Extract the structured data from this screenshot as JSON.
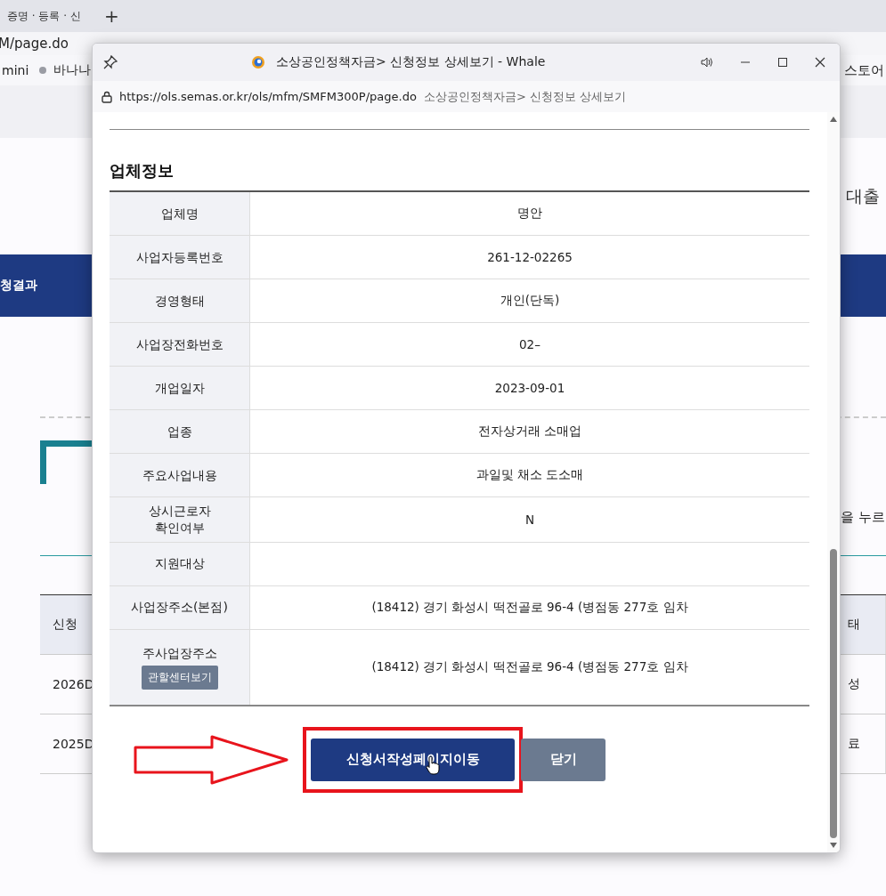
{
  "browser": {
    "tab_label": "증명 · 등록 · 신",
    "new_tab": "+",
    "address": "M/page.do",
    "bookmarks": [
      "mini",
      "바나나"
    ],
    "bookmark_right": "스토어"
  },
  "page": {
    "side_text": "대출",
    "nav_label": "청결과",
    "hint_text": "을 누르",
    "table": {
      "columns": [
        "신청",
        "",
        "",
        "",
        "",
        "",
        "",
        "태"
      ],
      "rows": [
        [
          "2026D",
          "",
          "",
          "",
          "",
          "",
          "",
          "성"
        ],
        [
          "2025D",
          "",
          "",
          "",
          "",
          "",
          "",
          "료"
        ]
      ]
    }
  },
  "popup": {
    "title": "소상공인정책자금> 신청정보 상세보기 - Whale",
    "url": "https://ols.semas.or.kr/ols/mfm/SMFM300P/page.do",
    "url_title": "소상공인정책자금> 신청정보 상세보기",
    "section_title": "업체정보",
    "fields": [
      {
        "label": "업체명",
        "value": "명안"
      },
      {
        "label": "사업자등록번호",
        "value": "261-12-02265"
      },
      {
        "label": "경영형태",
        "value": "개인(단독)"
      },
      {
        "label": "사업장전화번호",
        "value": "02–"
      },
      {
        "label": "개업일자",
        "value": "2023-09-01"
      },
      {
        "label": "업종",
        "value": "전자상거래 소매업"
      },
      {
        "label": "주요사업내용",
        "value": "과일및 채소 도소매"
      },
      {
        "label": "상시근로자\n확인여부",
        "value": "N"
      },
      {
        "label": "지원대상"
      },
      {
        "label": "사업장주소(본점)",
        "value": "(18412)  경기 화성시 떡전골로 96-4 (병점동 277호  임차"
      },
      {
        "label": "주사업장주소",
        "value": "(18412)  경기 화성시 떡전골로 96-4 (병점동 277호  임차",
        "button": "관할센터보기"
      }
    ],
    "buttons": [
      {
        "label": "신청서작성페이지이동",
        "kind": "primary",
        "highlighted": true
      },
      {
        "label": "닫기",
        "kind": "secondary",
        "highlighted": false
      }
    ]
  }
}
